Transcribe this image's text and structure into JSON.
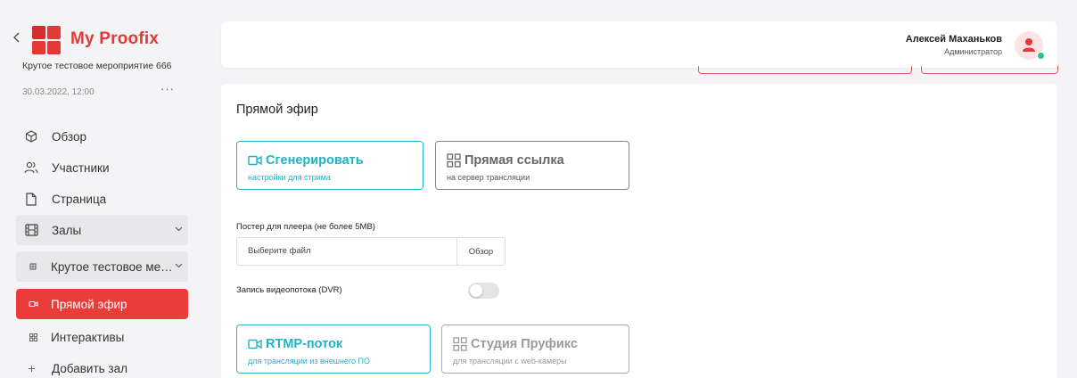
{
  "sidebar": {
    "brand": "My Proofix",
    "event_name": "Крутое тестовое мероприятие 666",
    "event_date": "30.03.2022, 12:00",
    "event_more": "···",
    "items": [
      {
        "label": "Обзор",
        "icon": "cube-icon"
      },
      {
        "label": "Участники",
        "icon": "users-icon"
      },
      {
        "label": "Страница",
        "icon": "page-icon"
      },
      {
        "label": "Залы",
        "icon": "film-icon"
      },
      {
        "label": "Крутое тестовое ме…",
        "icon": "hall-icon"
      },
      {
        "label": "Прямой эфир",
        "icon": "video-icon"
      },
      {
        "label": "Интерактивы",
        "icon": "grid-icon"
      },
      {
        "label": "Добавить зал",
        "icon": "plus-icon"
      }
    ]
  },
  "header": {
    "user_name": "Алексей Маханьков",
    "user_role": "Администратор"
  },
  "main": {
    "title": "Прямой эфир",
    "source_options": [
      {
        "title": "Сгенерировать",
        "subtitle": "настройки для стрима",
        "selected": true
      },
      {
        "title": "Прямая ссылка",
        "subtitle": "на сервер трансляции",
        "selected": false
      }
    ],
    "poster_label": "Постер для плеера (не более 5MB)",
    "file_placeholder": "Выберите файл",
    "file_button": "Обзор",
    "dvr_label": "Запись видеопотока (DVR)",
    "dvr_enabled": false,
    "stream_options": [
      {
        "title": "RTMP-поток",
        "subtitle": "для трансляции из внешнего ПО",
        "selected": true
      },
      {
        "title": "Студия Пруфикс",
        "subtitle": "для трансляции с web-камеры",
        "selected": false
      }
    ]
  },
  "colors": {
    "accent_red": "#ec3b3b",
    "brand_red": "#e53935",
    "selected_teal": "#1fb3c6",
    "online_green": "#2ec37a"
  }
}
